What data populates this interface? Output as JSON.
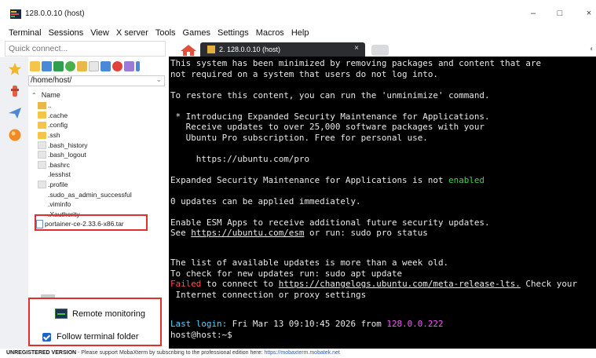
{
  "window": {
    "title": "128.0.0.10 (host)",
    "minimize": "–",
    "maximize": "□",
    "close": "×"
  },
  "menu": [
    "Terminal",
    "Sessions",
    "View",
    "X server",
    "Tools",
    "Games",
    "Settings",
    "Macros",
    "Help"
  ],
  "quick_connect": {
    "placeholder": "Quick connect..."
  },
  "file_panel": {
    "path": "/home/host/",
    "column_header": "Name",
    "files": [
      {
        "name": "..",
        "type": "up"
      },
      {
        "name": ".cache",
        "type": "folder"
      },
      {
        "name": ".config",
        "type": "folder"
      },
      {
        "name": ".ssh",
        "type": "folder"
      },
      {
        "name": ".bash_history",
        "type": "doc"
      },
      {
        "name": ".bash_logout",
        "type": "doc"
      },
      {
        "name": ".bashrc",
        "type": "doc"
      },
      {
        "name": ".lesshst",
        "type": "blank"
      },
      {
        "name": ".profile",
        "type": "doc"
      },
      {
        "name": ".sudo_as_admin_successful",
        "type": "blank"
      },
      {
        "name": ".viminfo",
        "type": "blank"
      },
      {
        "name": ".Xauthority",
        "type": "blank"
      },
      {
        "name": "portainer-ce-2.33.6-x86.tar",
        "type": "tar"
      }
    ]
  },
  "bottom_panel": {
    "remote_monitoring": "Remote monitoring",
    "follow_terminal_folder": "Follow terminal folder",
    "follow_checked": true
  },
  "tab": {
    "label": "2. 128.0.0.10 (host)",
    "close": "×"
  },
  "terminal": {
    "lines": [
      "This system has been minimized by removing packages and content that are",
      "not required on a system that users do not log into.",
      "",
      "To restore this content, you can run the 'unminimize' command.",
      "",
      " * Introducing Expanded Security Maintenance for Applications.",
      "   Receive updates to over 25,000 software packages with your",
      "   Ubuntu Pro subscription. Free for personal use.",
      "",
      "     https://ubuntu.com/pro",
      "",
      "Expanded Security Maintenance for Applications is not ",
      "enabled",
      "0 updates can be applied immediately.",
      "Enable ESM Apps to receive additional future security updates.",
      "See ",
      "https://ubuntu.com/esm",
      " or run: sudo pro status",
      "The list of available updates is more than a week old.",
      "To check for new updates run: sudo apt update",
      "Failed",
      " to connect to ",
      "https://changelogs.ubuntu.com/meta-release-lts.",
      " Check your",
      " Internet connection or proxy settings",
      "Last login:",
      " Fri Mar 13 09:10:45 2026 from ",
      "128.0.0.222",
      "host@host:~$"
    ]
  },
  "status_bar": {
    "label": "UNREGISTERED VERSION",
    "message": "  -  Please support MobaXterm by subscribing to the professional edition here:  ",
    "link": "https://mobaxterm.mobatek.net"
  },
  "colors": {
    "terminal_bg": "#000000",
    "highlight_box": "#e0302e",
    "ok_green": "#3fd24b",
    "fail_red": "#ff4b4b",
    "login_cyan": "#5bd2ff",
    "ip_magenta": "#ff55ff"
  }
}
